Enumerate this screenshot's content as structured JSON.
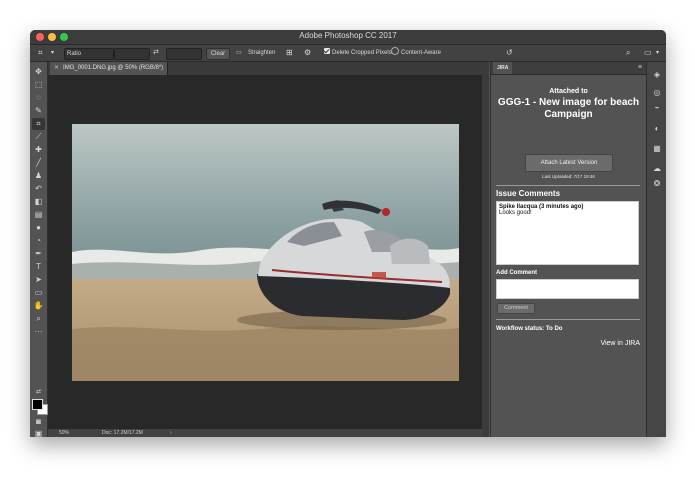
{
  "window": {
    "title": "Adobe Photoshop CC 2017"
  },
  "options_bar": {
    "ratio_label": "Ratio",
    "clear_label": "Clear",
    "straighten_label": "Straighten",
    "delete_cropped_label": "Delete Cropped Pixels",
    "delete_cropped_checked": true,
    "content_aware_label": "Content-Aware",
    "content_aware_checked": false
  },
  "document": {
    "tab_title": "IMG_0001.DNG.jpg @ 50% (RGB/8*)",
    "zoom": "50%",
    "doc_size": "Doc: 17.2M/17.2M"
  },
  "tools": [
    "move-tool",
    "marquee-tool",
    "lasso-tool",
    "quick-select-tool",
    "crop-tool",
    "eyedropper-tool",
    "healing-brush-tool",
    "brush-tool",
    "clone-stamp-tool",
    "history-brush-tool",
    "eraser-tool",
    "gradient-tool",
    "blur-tool",
    "dodge-tool",
    "pen-tool",
    "type-tool",
    "path-select-tool",
    "rectangle-tool",
    "hand-tool",
    "zoom-tool",
    "more-tools"
  ],
  "jira_panel": {
    "tab_label": "JIRA",
    "attached_to": "Attached to",
    "issue_title": "GGG-1 - New image for beach Campaign",
    "attach_button": "Attach Latest Version",
    "last_uploaded": "Last Uploaded: 7/17 19:46",
    "comments_heading": "Issue Comments",
    "comments": [
      {
        "author": "Spike Ilacqua (3 minutes ago)",
        "text": "Looks good!"
      }
    ],
    "add_comment_label": "Add Comment",
    "add_comment_value": "",
    "comment_button": "Comment",
    "workflow_status": "Workflow status: To Do",
    "view_in_jira": "View in JIRA"
  },
  "colors": {
    "window_bg": "#535353",
    "panel_bg": "#535353",
    "canvas_bg": "#282828",
    "foreground_swatch": "#000000",
    "background_swatch": "#ffffff"
  }
}
